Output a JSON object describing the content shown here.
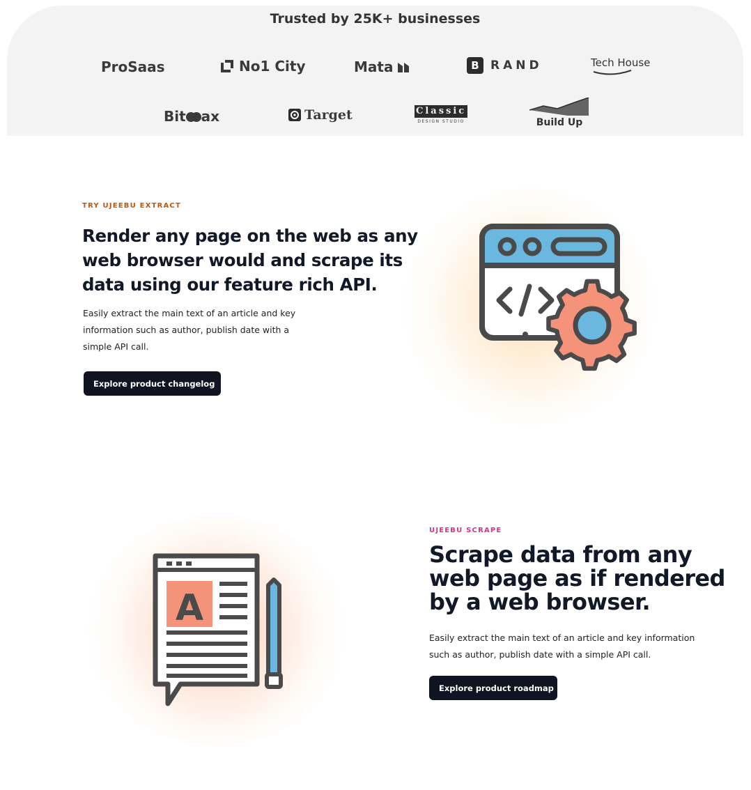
{
  "trusted": {
    "title": "Trusted by 25K+ businesses",
    "logos_row1": [
      "ProSaas",
      "No1 City",
      "Mata",
      "RAND",
      "Tech House"
    ],
    "logos_row2": [
      "Bit",
      "ax",
      "Target",
      "Classic",
      "DESIGN STUDIO",
      "Build Up"
    ],
    "brand_letter": "B"
  },
  "extract": {
    "eyebrow": "TRY UJEEBU EXTRACT",
    "eyebrow_color": "#c2570c",
    "heading_lines": [
      "Render any page on the web as any",
      "web browser would and scrape its",
      "data using our feature rich API."
    ],
    "body_lines": [
      "Easily extract the main text of an article and key",
      "information such as author, publish date with a",
      "simple API call."
    ],
    "cta_label": "Explore product changelog",
    "cta_arrow": "→",
    "icon": "browser-code-gear-icon"
  },
  "scrape": {
    "eyebrow": "UJEEBU SCRAPE",
    "eyebrow_color": "#d6338a",
    "heading_lines": [
      "Scrape data from any",
      "web page as if rendered",
      "by a web browser."
    ],
    "body_lines": [
      "Easily extract the main text of an article and key information",
      "such as author, publish date with a simple API call."
    ],
    "cta_label": "Explore product roadmap",
    "cta_arrow": "→",
    "icon": "article-pencil-icon",
    "icon_letter": "A"
  },
  "colors": {
    "dark": "#0f1420",
    "blue": "#6ab8df",
    "salmon": "#f5927a",
    "icon_stroke": "#4a4a4a"
  }
}
